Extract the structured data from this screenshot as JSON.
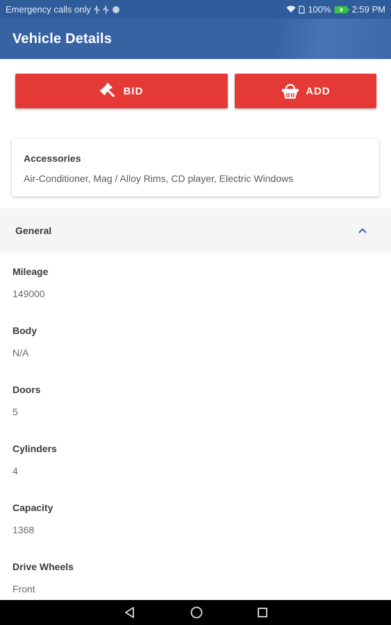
{
  "status_bar": {
    "carrier_text": "Emergency calls only",
    "battery_percent": "100%",
    "time": "2:59 PM"
  },
  "app_bar": {
    "title": "Vehicle Details"
  },
  "actions": {
    "bid_label": "BID",
    "add_label": "ADD"
  },
  "accessories": {
    "title": "Accessories",
    "text": "Air-Conditioner, Mag / Alloy Rims, CD player, Electric Windows"
  },
  "section": {
    "title": "General",
    "expanded": true
  },
  "fields": [
    {
      "label": "Mileage",
      "value": "149000"
    },
    {
      "label": "Body",
      "value": "N/A"
    },
    {
      "label": "Doors",
      "value": "5"
    },
    {
      "label": "Cylinders",
      "value": "4"
    },
    {
      "label": "Capacity",
      "value": "1368"
    },
    {
      "label": "Drive Wheels",
      "value": "Front"
    }
  ],
  "colors": {
    "primary": "#3763a3",
    "accent_red": "#e53935",
    "section_bg": "#f5f5f5"
  },
  "icons": {
    "bid": "gavel-icon",
    "add": "basket-icon",
    "collapse": "chevron-up-icon"
  }
}
